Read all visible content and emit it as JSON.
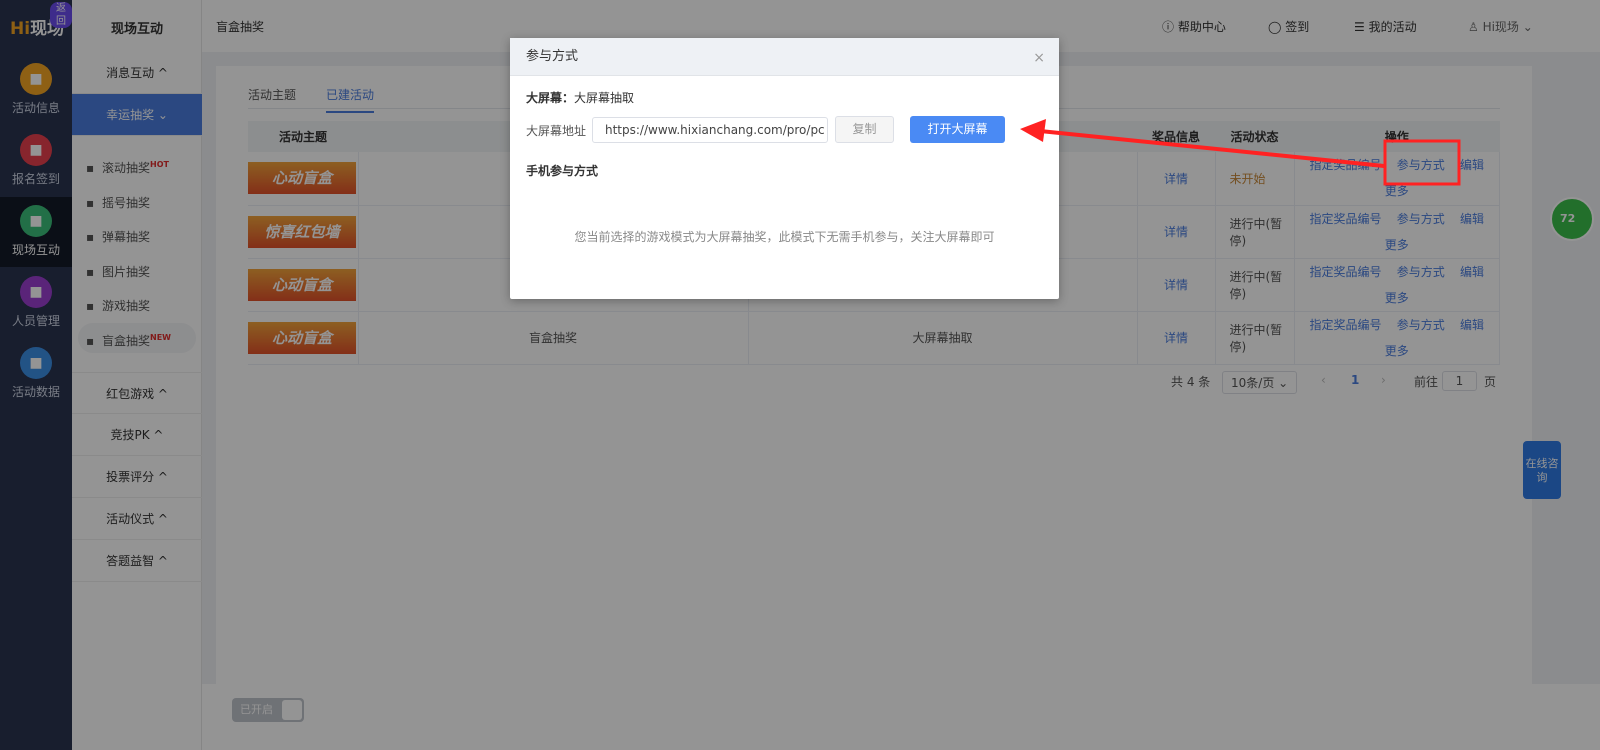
{
  "rail": {
    "logo": "Hi现场",
    "back": "返回",
    "items": [
      {
        "label": "活动信息",
        "color": "#f5a623",
        "icon": "document-icon"
      },
      {
        "label": "报名签到",
        "color": "#e8404e",
        "icon": "calendar-check-icon"
      },
      {
        "label": "现场互动",
        "color": "#3cbf7a",
        "icon": "interaction-icon"
      },
      {
        "label": "人员管理",
        "color": "#9b3fd1",
        "icon": "person-card-icon"
      },
      {
        "label": "活动数据",
        "color": "#3c8fe6",
        "icon": "bar-chart-icon"
      }
    ]
  },
  "side": {
    "title": "现场互动",
    "groups_top": [
      {
        "label": "消息互动 ^"
      },
      {
        "label": "幸运抽奖 ⌄"
      }
    ],
    "subs": [
      {
        "label": "滚动抽奖",
        "badge": "HOT",
        "icon": "gift-icon"
      },
      {
        "label": "摇号抽奖",
        "badge": "",
        "icon": "person-icon"
      },
      {
        "label": "弹幕抽奖",
        "badge": "",
        "icon": "barrage-icon"
      },
      {
        "label": "图片抽奖",
        "badge": "",
        "icon": "image-icon"
      },
      {
        "label": "游戏抽奖",
        "badge": "",
        "icon": "game-icon"
      },
      {
        "label": "盲盒抽奖",
        "badge": "NEW",
        "icon": "box-icon"
      }
    ],
    "groups_bottom": [
      {
        "label": "红包游戏 ^"
      },
      {
        "label": "竞技PK ^"
      },
      {
        "label": "投票评分 ^"
      },
      {
        "label": "活动仪式 ^"
      },
      {
        "label": "答题益智 ^"
      }
    ]
  },
  "top": {
    "breadcrumb": "盲盒抽奖",
    "help": "ⓘ 帮助中心",
    "checkin": "◯ 签到",
    "my": "☰ 我的活动",
    "user": "♙ Hi现场 ⌄"
  },
  "tabs": [
    "活动主题",
    "已建活动"
  ],
  "table": {
    "headers": [
      "活动主题",
      "",
      "",
      "奖品信息",
      "活动状态",
      "操作"
    ],
    "rows": [
      {
        "img": "心动盲盒",
        "name": "",
        "mode": "",
        "prize": "详情",
        "status": "未开始",
        "status_color": "#c8893a"
      },
      {
        "img": "惊喜红包墙",
        "name": "",
        "mode": "",
        "prize": "详情",
        "status": "进行中(暂停)",
        "status_color": "#555"
      },
      {
        "img": "心动盲盒",
        "name": "",
        "mode": "",
        "prize": "详情",
        "status": "进行中(暂停)",
        "status_color": "#555"
      },
      {
        "img": "心动盲盒",
        "name": "盲盒抽奖",
        "mode": "大屏幕抽取",
        "prize": "详情",
        "status": "进行中(暂停)",
        "status_color": "#555"
      }
    ],
    "ops": [
      "指定奖品编号",
      "参与方式",
      "编辑",
      "更多"
    ]
  },
  "pagination": {
    "total": "共 4 条",
    "size": "10条/页 ⌄",
    "prev": "‹",
    "page": "1",
    "next": "›",
    "goto": "前往",
    "goto_val": "1",
    "unit": "页"
  },
  "footer": {
    "toggle": "已开启"
  },
  "dialog": {
    "title": "参与方式",
    "close": "×",
    "screen_label": "大屏幕：",
    "screen_value": "大屏幕抽取",
    "url_label": "大屏幕地址",
    "url": "https://www.hixianchang.com/pro/pc",
    "copy": "复制",
    "open": "打开大屏幕",
    "mobile_title": "手机参与方式",
    "mobile_note": "您当前选择的游戏模式为大屏幕抽奖，此模式下无需手机参与，关注大屏幕即可"
  },
  "chat": "在线咨询",
  "ball": "72"
}
